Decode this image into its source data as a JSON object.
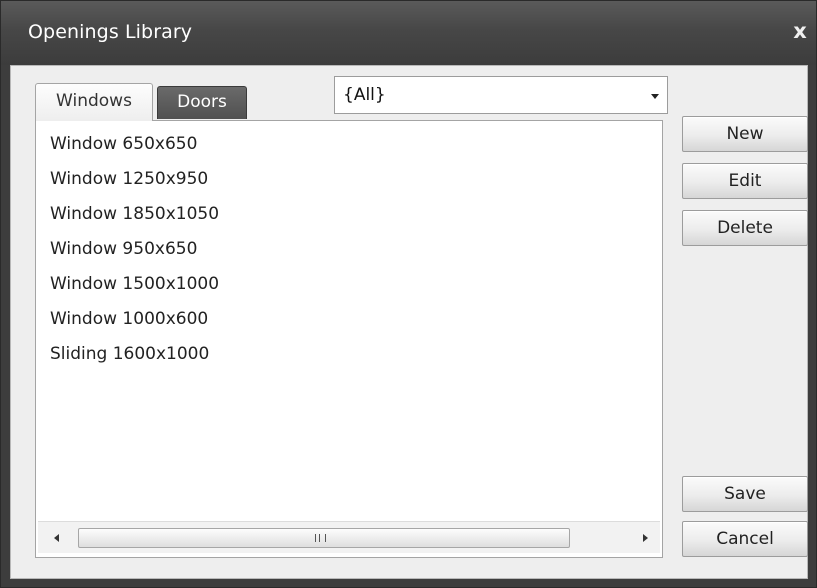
{
  "window": {
    "title": "Openings Library",
    "close_symbol": "x"
  },
  "tabs": [
    {
      "label": "Windows",
      "selected": true
    },
    {
      "label": "Doors",
      "selected": false
    }
  ],
  "filter": {
    "selected": "{All}"
  },
  "openings": [
    "Window 650x650",
    "Window 1250x950",
    "Window 1850x1050",
    "Window 950x650",
    "Window 1500x1000",
    "Window 1000x600",
    "Sliding 1600x1000"
  ],
  "buttons": {
    "new": "New",
    "edit": "Edit",
    "delete": "Delete",
    "save": "Save",
    "cancel": "Cancel"
  },
  "icons": {
    "close": "close-icon",
    "dropdown": "chevron-down-icon",
    "scroll_left": "arrow-left-icon",
    "scroll_right": "arrow-right-icon"
  }
}
